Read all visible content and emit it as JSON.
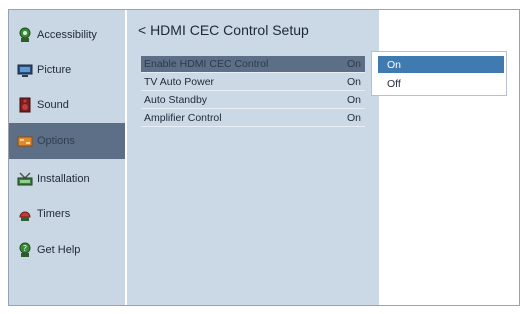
{
  "sidebar": {
    "items": [
      {
        "label": "Accessibility",
        "icon": "accessibility-icon"
      },
      {
        "label": "Picture",
        "icon": "picture-icon"
      },
      {
        "label": "Sound",
        "icon": "sound-icon"
      },
      {
        "label": "Options",
        "icon": "options-icon",
        "selected": true
      },
      {
        "label": "Installation",
        "icon": "installation-icon"
      },
      {
        "label": "Timers",
        "icon": "timers-icon"
      },
      {
        "label": "Get Help",
        "icon": "get-help-icon"
      }
    ]
  },
  "main": {
    "title": "< HDMI CEC Control Setup",
    "rows": [
      {
        "label": "Enable HDMI CEC Control",
        "value": "On",
        "selected": true
      },
      {
        "label": "TV Auto Power",
        "value": "On"
      },
      {
        "label": "Auto Standby",
        "value": "On"
      },
      {
        "label": "Amplifier Control",
        "value": "On"
      }
    ]
  },
  "dropdown": {
    "options": [
      {
        "label": "On",
        "selected": true
      },
      {
        "label": "Off"
      }
    ]
  },
  "colors": {
    "sidebar_bg": "#c9d6e4",
    "main_bg": "#cbd8e6",
    "selection": "#5d6f86",
    "dropdown_selection": "#3f7bb0"
  }
}
